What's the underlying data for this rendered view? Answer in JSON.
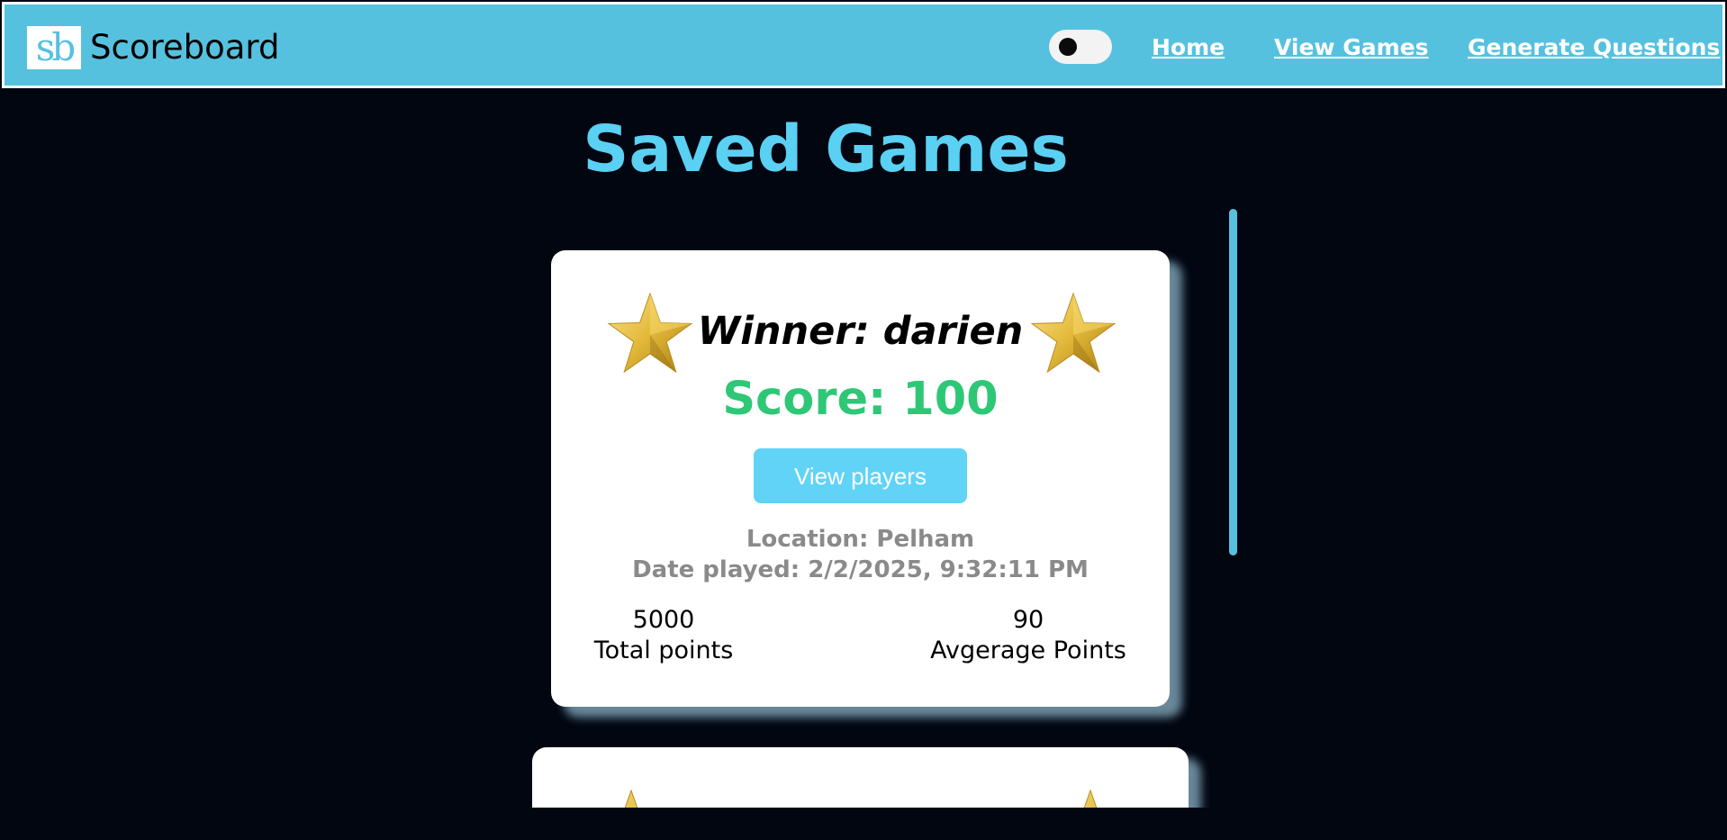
{
  "navbar": {
    "logo_text": "sb",
    "brand": "Scoreboard",
    "links": [
      "Home",
      "View Games",
      "Generate Questions"
    ],
    "bg_color": "#56c1df"
  },
  "page": {
    "title": "Saved Games",
    "title_color": "#5ad0f3",
    "background": "#010611"
  },
  "games": [
    {
      "winner": "Winner: darien",
      "score": "Score: 100",
      "view_button": "View players",
      "location": "Location: Pelham",
      "date_played": "Date played: 2/2/2025, 9:32:11 PM",
      "total_points": "5000",
      "total_points_label": "Total points",
      "average_points": "90",
      "average_points_label": "Avgerage Points",
      "score_color": "#2ec776"
    }
  ],
  "icons": {
    "star": "star-icon",
    "toggle": "theme-toggle"
  }
}
